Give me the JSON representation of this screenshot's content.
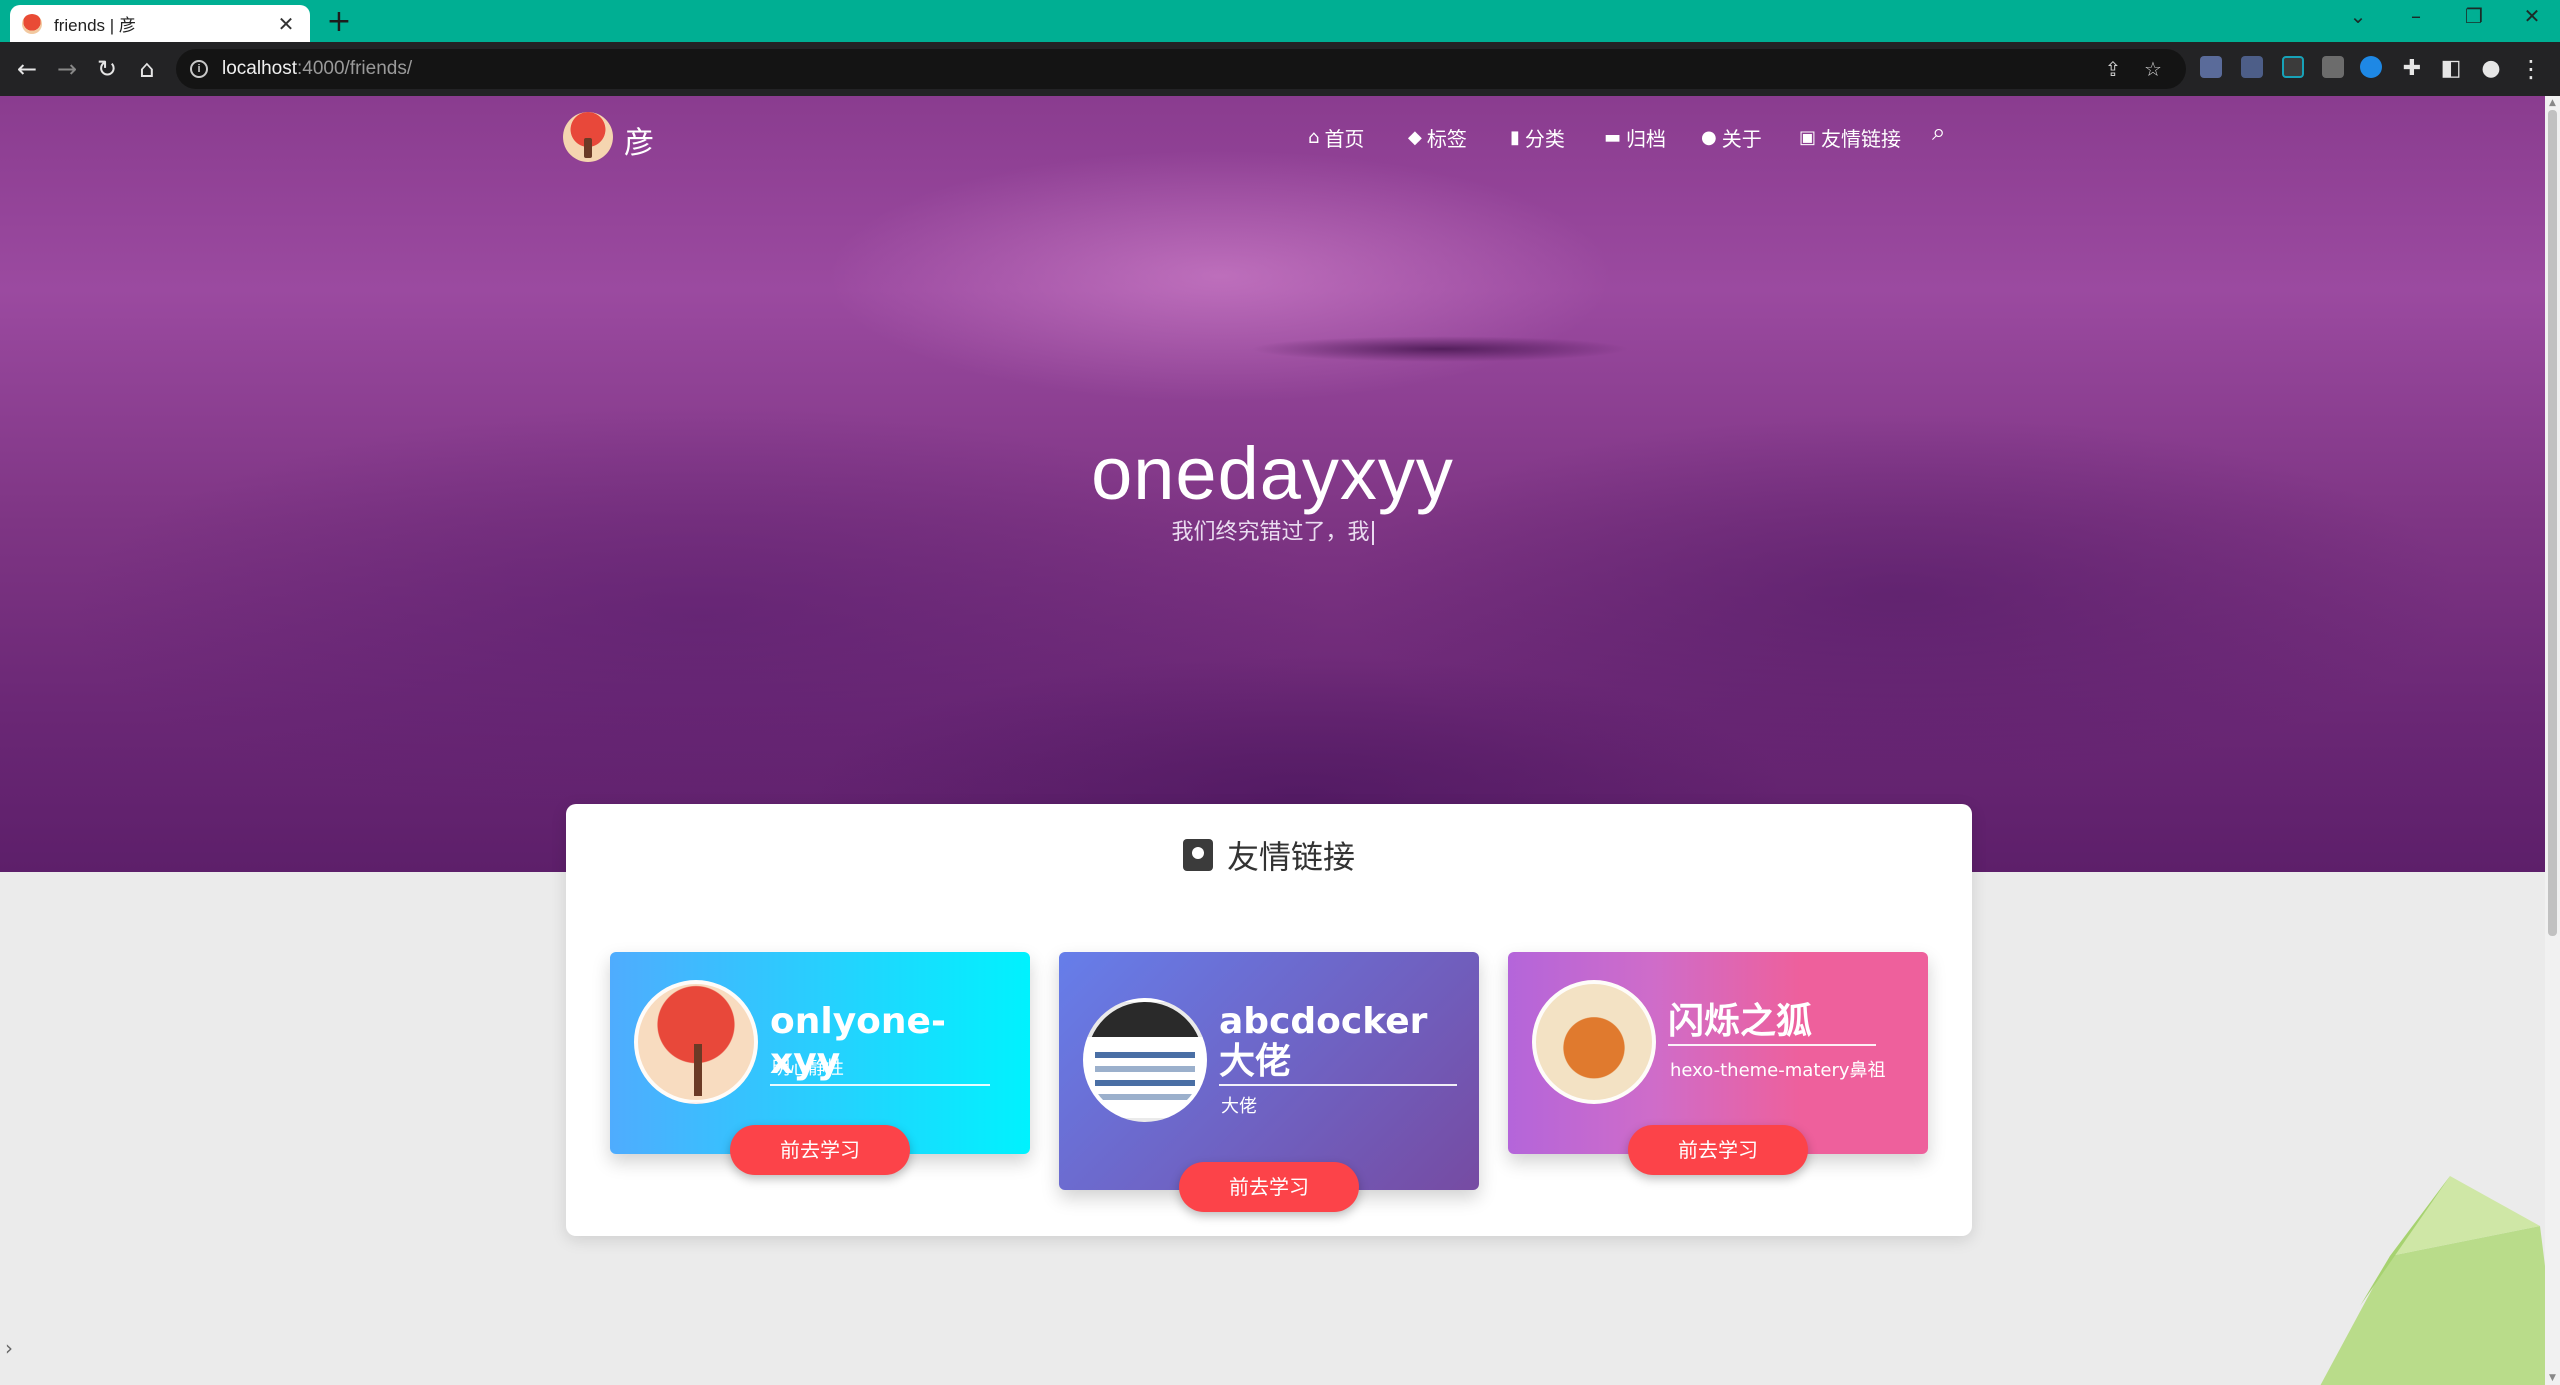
{
  "browser": {
    "tab_title": "friends | 彦",
    "url_host": "localhost",
    "url_path": ":4000/friends/",
    "tab_close": "✕",
    "new_tab": "+"
  },
  "site": {
    "title": "彦",
    "nav": [
      {
        "icon": "home-icon",
        "glyph": "⌂",
        "label": "首页"
      },
      {
        "icon": "tags-icon",
        "glyph": "◆",
        "label": "标签"
      },
      {
        "icon": "bookmark-icon",
        "glyph": "▮",
        "label": "分类"
      },
      {
        "icon": "archive-icon",
        "glyph": "▬",
        "label": "归档"
      },
      {
        "icon": "user-circle-icon",
        "glyph": "●",
        "label": "关于"
      },
      {
        "icon": "address-book-icon",
        "glyph": "▣",
        "label": "友情链接"
      }
    ],
    "search_glyph": "⌕"
  },
  "hero": {
    "title": "onedayxyy",
    "subtitle": "我们终究错过了，我"
  },
  "friends_section": {
    "title": "友情链接",
    "items": [
      {
        "name": "onlyone-xyy",
        "desc": "明心静性",
        "button": "前去学习"
      },
      {
        "name": "abcdocker大佬",
        "desc": "大佬",
        "button": "前去学习"
      },
      {
        "name": "闪烁之狐",
        "desc": "hexo-theme-matery鼻祖",
        "button": "前去学习"
      }
    ]
  },
  "colors": {
    "button_red": "#fc4349",
    "tabstrip_green": "#00af93",
    "card1_gradient": [
      "#4facfe",
      "#00f2fe"
    ],
    "card2_gradient": [
      "#667eea",
      "#764ba2"
    ],
    "card3_gradient": [
      "#b465da",
      "#ee609c"
    ]
  }
}
